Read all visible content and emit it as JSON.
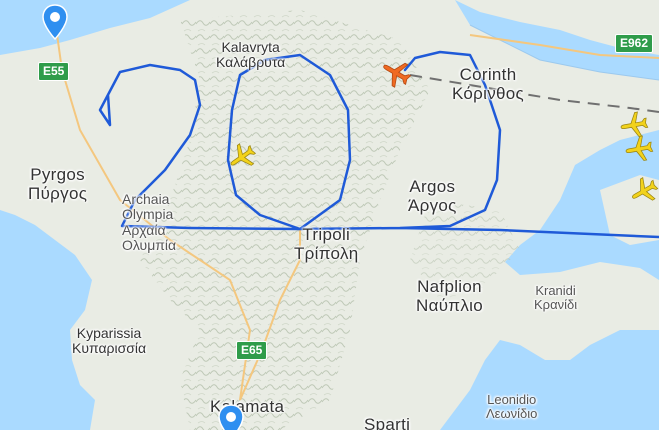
{
  "colors": {
    "sea": "#aadaff",
    "land": "#e9ece4",
    "terrain": "#c7d1c0",
    "flight_path": "#1f5ad8",
    "aircraft_default": "#f2d21b",
    "aircraft_selected": "#f06a22",
    "road_shield": "#2f9c4a",
    "pin": "#2f8ff0"
  },
  "places": [
    {
      "id": "kalavryta",
      "latin": "Kalavryta",
      "greek": "Καλάβρυτα"
    },
    {
      "id": "corinth",
      "latin": "Corinth",
      "greek": "Κόρινθος"
    },
    {
      "id": "pyrgos",
      "latin": "Pyrgos",
      "greek": "Πύργος"
    },
    {
      "id": "archaia-olympia",
      "latin": "Archaia\nOlympia",
      "greek": "Αρχαία\nΟλυμπία"
    },
    {
      "id": "argos",
      "latin": "Argos",
      "greek": "Άργος"
    },
    {
      "id": "tripoli",
      "latin": "Tripoli",
      "greek": "Τρίπολη"
    },
    {
      "id": "nafplion",
      "latin": "Nafplion",
      "greek": "Ναύπλιο"
    },
    {
      "id": "kranidi",
      "latin": "Kranidi",
      "greek": "Κρανίδι"
    },
    {
      "id": "kyparissia",
      "latin": "Kyparissia",
      "greek": "Κυπαρισσία"
    },
    {
      "id": "leonidio",
      "latin": "Leonidio",
      "greek": "Λεωνίδιο"
    },
    {
      "id": "kalamata",
      "latin": "Kalamata",
      "greek": ""
    },
    {
      "id": "sparti",
      "latin": "Sparti",
      "greek": ""
    }
  ],
  "roads": [
    {
      "id": "e55",
      "label": "E55"
    },
    {
      "id": "e962",
      "label": "E962"
    },
    {
      "id": "e65",
      "label": "E65"
    }
  ],
  "aircraft": [
    {
      "id": "selected",
      "icon": "airplane-icon",
      "state": "selected"
    },
    {
      "id": "over-kalavryta",
      "icon": "airplane-icon",
      "state": "default"
    },
    {
      "id": "east-1",
      "icon": "airplane-icon",
      "state": "default"
    },
    {
      "id": "east-2",
      "icon": "airplane-icon",
      "state": "default"
    },
    {
      "id": "east-3",
      "icon": "airplane-icon",
      "state": "default"
    }
  ],
  "pins": [
    {
      "id": "north-west",
      "icon": "location-pin-icon"
    },
    {
      "id": "kalamata",
      "icon": "location-pin-icon"
    }
  ]
}
